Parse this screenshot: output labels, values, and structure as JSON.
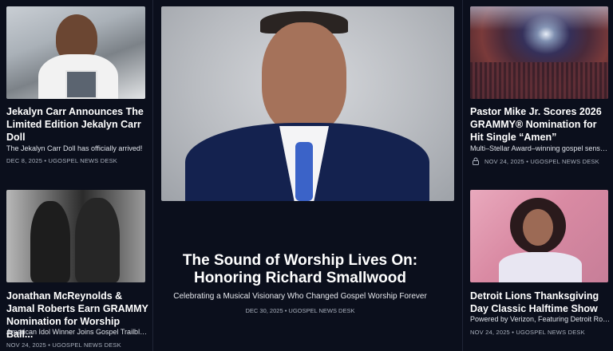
{
  "cards": {
    "jekalyn": {
      "title": "Jekalyn Carr Announces The Limited Edition Jekalyn Carr Doll",
      "excerpt": "The Jekalyn Carr Doll has officially arrived!",
      "meta": "DEC 8, 2025 • UGOSPEL NEWS DESK"
    },
    "pastor_mike": {
      "title": "Pastor Mike Jr. Scores 2026 GRAMMY® Nomination for Hit Single “Amen”",
      "excerpt": "Multi–Stellar Award–winning gospel sensati...",
      "meta": "NOV 24, 2025 • UGOSPEL NEWS DESK",
      "icon": "lock-icon"
    },
    "mcreynolds": {
      "title": "Jonathan McReynolds & Jamal Roberts Earn GRAMMY Nomination for Worship Ball...",
      "excerpt": "American Idol Winner Joins Gospel Trailblaz...",
      "meta": "NOV 24, 2025 • UGOSPEL NEWS DESK"
    },
    "lions": {
      "title": "Detroit Lions Thanksgiving Day Classic Halftime Show",
      "excerpt": "Powered by Verizon, Featuring Detroit Rock...",
      "meta": "NOV 24, 2025 • UGOSPEL NEWS DESK"
    }
  },
  "feature": {
    "title_line1": "The Sound of Worship Lives On:",
    "title_line2": "Honoring Richard Smallwood",
    "subtitle": "Celebrating a Musical Visionary Who Changed Gospel Worship Forever",
    "meta": "DEC 30, 2025 • UGOSPEL NEWS DESK"
  },
  "colors": {
    "background": "#0b0f1c",
    "text": "#ffffff",
    "meta": "#a9b0bd"
  }
}
